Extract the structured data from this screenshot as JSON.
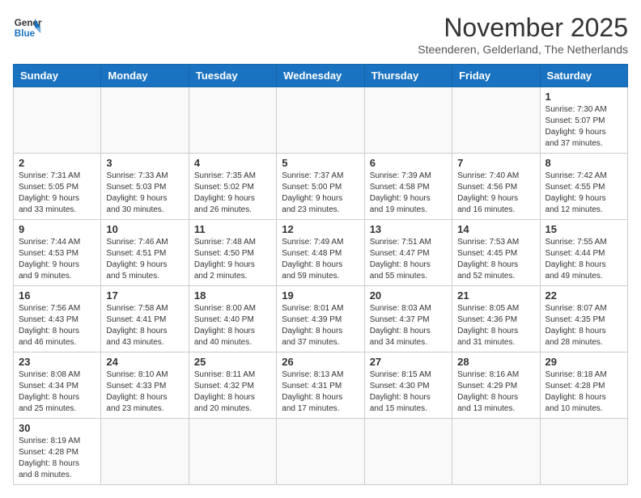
{
  "logo": {
    "text_general": "General",
    "text_blue": "Blue"
  },
  "title": "November 2025",
  "subtitle": "Steenderen, Gelderland, The Netherlands",
  "weekdays": [
    "Sunday",
    "Monday",
    "Tuesday",
    "Wednesday",
    "Thursday",
    "Friday",
    "Saturday"
  ],
  "weeks": [
    [
      {
        "day": "",
        "info": ""
      },
      {
        "day": "",
        "info": ""
      },
      {
        "day": "",
        "info": ""
      },
      {
        "day": "",
        "info": ""
      },
      {
        "day": "",
        "info": ""
      },
      {
        "day": "",
        "info": ""
      },
      {
        "day": "1",
        "info": "Sunrise: 7:30 AM\nSunset: 5:07 PM\nDaylight: 9 hours\nand 37 minutes."
      }
    ],
    [
      {
        "day": "2",
        "info": "Sunrise: 7:31 AM\nSunset: 5:05 PM\nDaylight: 9 hours\nand 33 minutes."
      },
      {
        "day": "3",
        "info": "Sunrise: 7:33 AM\nSunset: 5:03 PM\nDaylight: 9 hours\nand 30 minutes."
      },
      {
        "day": "4",
        "info": "Sunrise: 7:35 AM\nSunset: 5:02 PM\nDaylight: 9 hours\nand 26 minutes."
      },
      {
        "day": "5",
        "info": "Sunrise: 7:37 AM\nSunset: 5:00 PM\nDaylight: 9 hours\nand 23 minutes."
      },
      {
        "day": "6",
        "info": "Sunrise: 7:39 AM\nSunset: 4:58 PM\nDaylight: 9 hours\nand 19 minutes."
      },
      {
        "day": "7",
        "info": "Sunrise: 7:40 AM\nSunset: 4:56 PM\nDaylight: 9 hours\nand 16 minutes."
      },
      {
        "day": "8",
        "info": "Sunrise: 7:42 AM\nSunset: 4:55 PM\nDaylight: 9 hours\nand 12 minutes."
      }
    ],
    [
      {
        "day": "9",
        "info": "Sunrise: 7:44 AM\nSunset: 4:53 PM\nDaylight: 9 hours\nand 9 minutes."
      },
      {
        "day": "10",
        "info": "Sunrise: 7:46 AM\nSunset: 4:51 PM\nDaylight: 9 hours\nand 5 minutes."
      },
      {
        "day": "11",
        "info": "Sunrise: 7:48 AM\nSunset: 4:50 PM\nDaylight: 9 hours\nand 2 minutes."
      },
      {
        "day": "12",
        "info": "Sunrise: 7:49 AM\nSunset: 4:48 PM\nDaylight: 8 hours\nand 59 minutes."
      },
      {
        "day": "13",
        "info": "Sunrise: 7:51 AM\nSunset: 4:47 PM\nDaylight: 8 hours\nand 55 minutes."
      },
      {
        "day": "14",
        "info": "Sunrise: 7:53 AM\nSunset: 4:45 PM\nDaylight: 8 hours\nand 52 minutes."
      },
      {
        "day": "15",
        "info": "Sunrise: 7:55 AM\nSunset: 4:44 PM\nDaylight: 8 hours\nand 49 minutes."
      }
    ],
    [
      {
        "day": "16",
        "info": "Sunrise: 7:56 AM\nSunset: 4:43 PM\nDaylight: 8 hours\nand 46 minutes."
      },
      {
        "day": "17",
        "info": "Sunrise: 7:58 AM\nSunset: 4:41 PM\nDaylight: 8 hours\nand 43 minutes."
      },
      {
        "day": "18",
        "info": "Sunrise: 8:00 AM\nSunset: 4:40 PM\nDaylight: 8 hours\nand 40 minutes."
      },
      {
        "day": "19",
        "info": "Sunrise: 8:01 AM\nSunset: 4:39 PM\nDaylight: 8 hours\nand 37 minutes."
      },
      {
        "day": "20",
        "info": "Sunrise: 8:03 AM\nSunset: 4:37 PM\nDaylight: 8 hours\nand 34 minutes."
      },
      {
        "day": "21",
        "info": "Sunrise: 8:05 AM\nSunset: 4:36 PM\nDaylight: 8 hours\nand 31 minutes."
      },
      {
        "day": "22",
        "info": "Sunrise: 8:07 AM\nSunset: 4:35 PM\nDaylight: 8 hours\nand 28 minutes."
      }
    ],
    [
      {
        "day": "23",
        "info": "Sunrise: 8:08 AM\nSunset: 4:34 PM\nDaylight: 8 hours\nand 25 minutes."
      },
      {
        "day": "24",
        "info": "Sunrise: 8:10 AM\nSunset: 4:33 PM\nDaylight: 8 hours\nand 23 minutes."
      },
      {
        "day": "25",
        "info": "Sunrise: 8:11 AM\nSunset: 4:32 PM\nDaylight: 8 hours\nand 20 minutes."
      },
      {
        "day": "26",
        "info": "Sunrise: 8:13 AM\nSunset: 4:31 PM\nDaylight: 8 hours\nand 17 minutes."
      },
      {
        "day": "27",
        "info": "Sunrise: 8:15 AM\nSunset: 4:30 PM\nDaylight: 8 hours\nand 15 minutes."
      },
      {
        "day": "28",
        "info": "Sunrise: 8:16 AM\nSunset: 4:29 PM\nDaylight: 8 hours\nand 13 minutes."
      },
      {
        "day": "29",
        "info": "Sunrise: 8:18 AM\nSunset: 4:28 PM\nDaylight: 8 hours\nand 10 minutes."
      }
    ],
    [
      {
        "day": "30",
        "info": "Sunrise: 8:19 AM\nSunset: 4:28 PM\nDaylight: 8 hours\nand 8 minutes."
      },
      {
        "day": "",
        "info": ""
      },
      {
        "day": "",
        "info": ""
      },
      {
        "day": "",
        "info": ""
      },
      {
        "day": "",
        "info": ""
      },
      {
        "day": "",
        "info": ""
      },
      {
        "day": "",
        "info": ""
      }
    ]
  ]
}
